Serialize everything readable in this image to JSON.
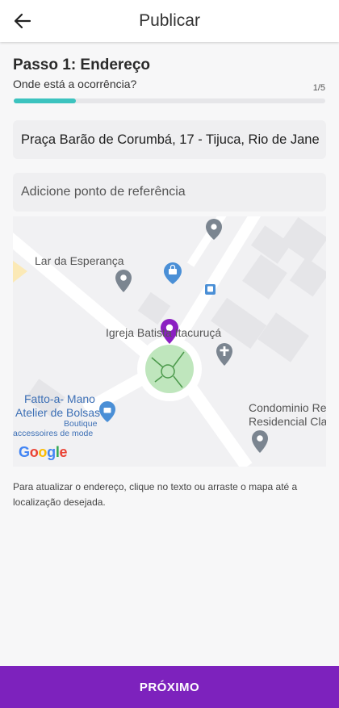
{
  "header": {
    "title": "Publicar",
    "back_icon": "arrow-left-icon"
  },
  "step": {
    "title": "Passo 1: Endereço",
    "subtitle": "Onde está a ocorrência?",
    "counter": "1/5",
    "progress": 0.2
  },
  "address": {
    "value": "Praça Barão de Corumbá, 17 - Tijuca, Rio de Jane"
  },
  "reference": {
    "placeholder": "Adicione ponto de referência"
  },
  "map": {
    "labels": {
      "lar": "Lar da Esperança",
      "igreja": "Igreja Batista Itacuruçá",
      "fatto1": "Fatto-a- Mano",
      "fatto2": "Atelier de Bolsas",
      "boutique1": "Boutique",
      "boutique2": "accessoires de mode",
      "condo1": "Condominio Re",
      "condo2": "Residencial Cla"
    },
    "attribution": "Google",
    "colors": {
      "pin": "#8b1fc2",
      "zone": "#bfe6bd",
      "poi_gray": "#7b8590",
      "poi_blue": "#4a8fd6"
    }
  },
  "hint": "Para atualizar o endereço, clique no texto ou arraste o mapa até a localização desejada.",
  "footer": {
    "next_label": "PRÓXIMO",
    "color": "#7d22bd"
  }
}
